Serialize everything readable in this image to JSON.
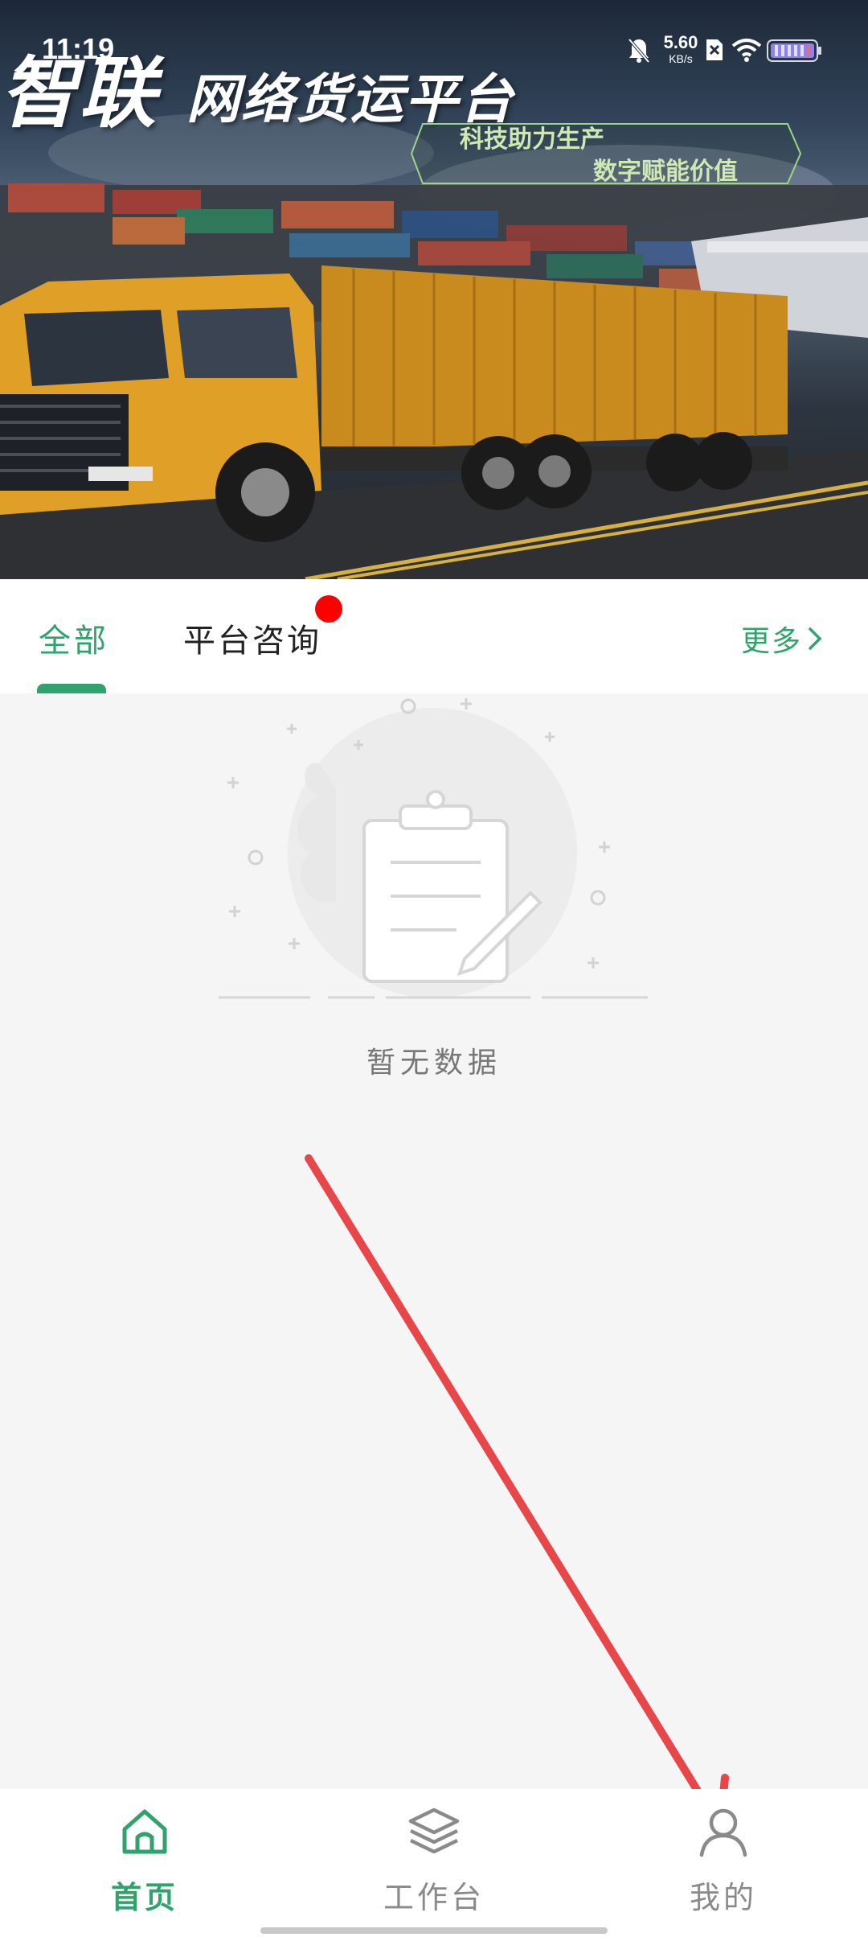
{
  "status_bar": {
    "time": "11:19",
    "net_speed_value": "5.60",
    "net_speed_unit": "KB/s",
    "icons": [
      "bell-muted-icon",
      "sim-x-icon",
      "wifi-icon",
      "battery-icon"
    ]
  },
  "banner": {
    "brand": "智联",
    "title": "网络货运平台",
    "slogan_line1": "科技助力生产",
    "slogan_line2": "数字赋能价值"
  },
  "tabs": {
    "items": [
      {
        "label": "全部",
        "active": true
      },
      {
        "label": "平台咨询",
        "active": false,
        "has_badge": true
      }
    ],
    "more_label": "更多"
  },
  "empty_state": {
    "text": "暂无数据"
  },
  "bottom_nav": {
    "items": [
      {
        "label": "首页",
        "icon": "home-icon",
        "active": true
      },
      {
        "label": "工作台",
        "icon": "layers-icon",
        "active": false
      },
      {
        "label": "我的",
        "icon": "user-icon",
        "active": false
      }
    ]
  },
  "colors": {
    "accent": "#2fa36b",
    "badge": "#ff0000",
    "annotation_arrow": "#e8474a",
    "background": "#f5f5f6"
  }
}
